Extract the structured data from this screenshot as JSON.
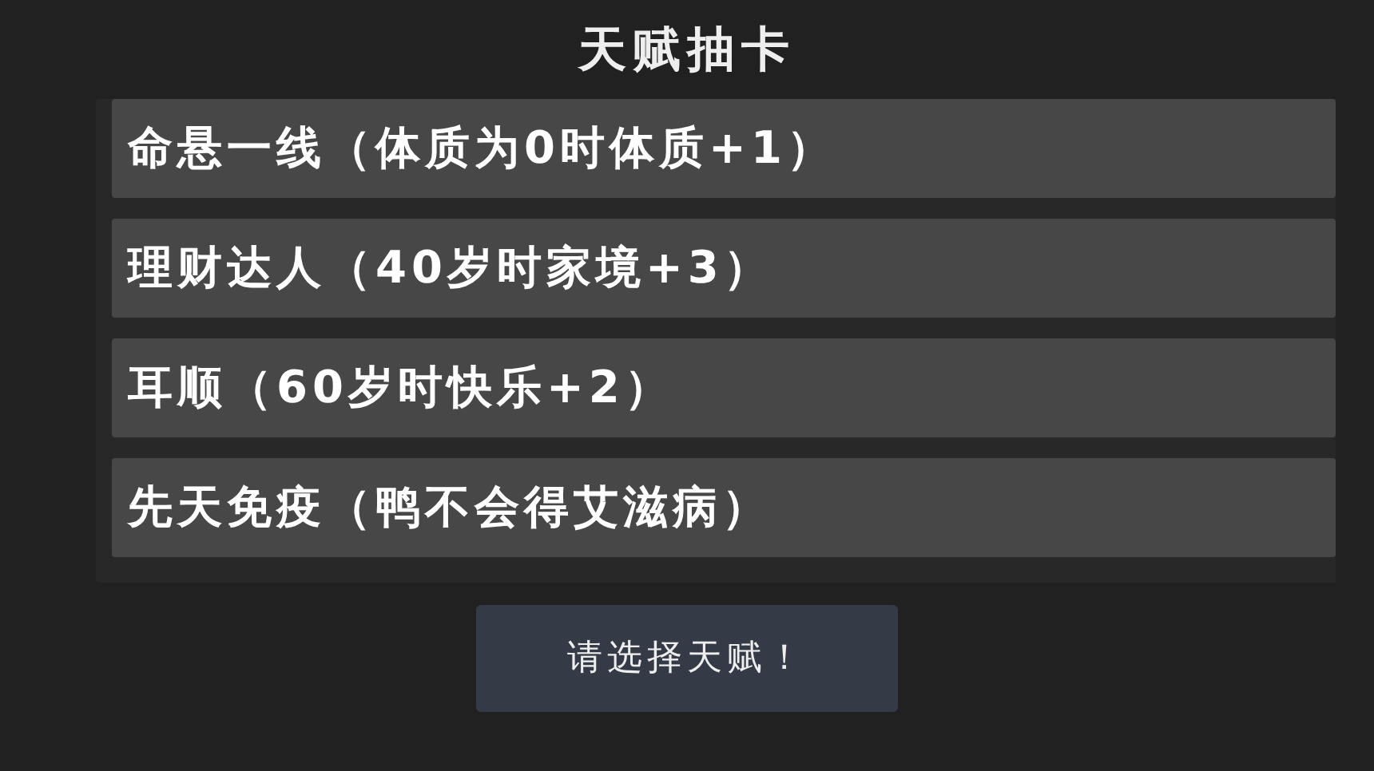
{
  "title": "天赋抽卡",
  "talents": [
    {
      "label": "命悬一线（体质为0时体质+1）"
    },
    {
      "label": "理财达人（40岁时家境+3）"
    },
    {
      "label": "耳顺（60岁时快乐+2）"
    },
    {
      "label": "先天免疫（鸭不会得艾滋病）"
    }
  ],
  "confirm_button": "请选择天赋！"
}
